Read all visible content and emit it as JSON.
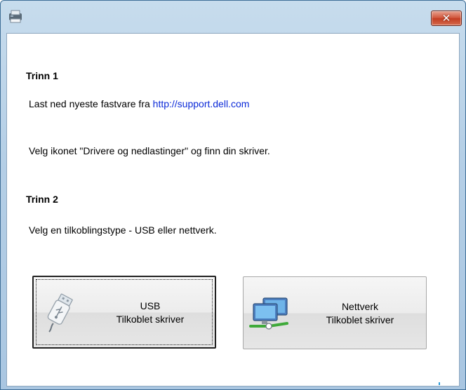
{
  "window": {
    "title": ""
  },
  "step1": {
    "heading": "Trinn 1",
    "download_prefix": "Last ned nyeste fastvare fra ",
    "download_link": "http://support.dell.com",
    "instruction": "Velg ikonet \"Drivere og nedlastinger\" og finn din skriver."
  },
  "step2": {
    "heading": "Trinn 2",
    "instruction": "Velg en tilkoblingstype - USB eller nettverk."
  },
  "buttons": {
    "usb": {
      "line1": "USB",
      "line2": "Tilkoblet skriver",
      "icon": "usb-drive-icon"
    },
    "network": {
      "line1": "Nettverk",
      "line2": "Tilkoblet skriver",
      "icon": "network-computers-icon"
    }
  },
  "colors": {
    "link": "#0b2ad8",
    "close_button": "#c33d22",
    "title_bar": "#b5cfe6"
  }
}
